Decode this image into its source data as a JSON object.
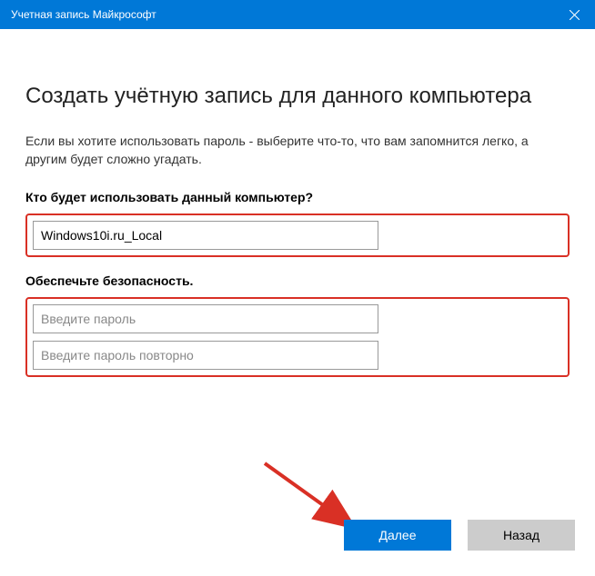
{
  "titlebar": {
    "title": "Учетная запись Майкрософт"
  },
  "page": {
    "heading": "Создать учётную запись для данного компьютера",
    "description": "Если вы хотите использовать пароль - выберите что-то, что вам запомнится легко, а другим будет сложно угадать."
  },
  "fields": {
    "username_label": "Кто будет использовать данный компьютер?",
    "username_value": "Windows10i.ru_Local",
    "security_label": "Обеспечьте безопасность.",
    "password_placeholder": "Введите пароль",
    "password_confirm_placeholder": "Введите пароль повторно"
  },
  "buttons": {
    "next": "Далее",
    "back": "Назад"
  }
}
